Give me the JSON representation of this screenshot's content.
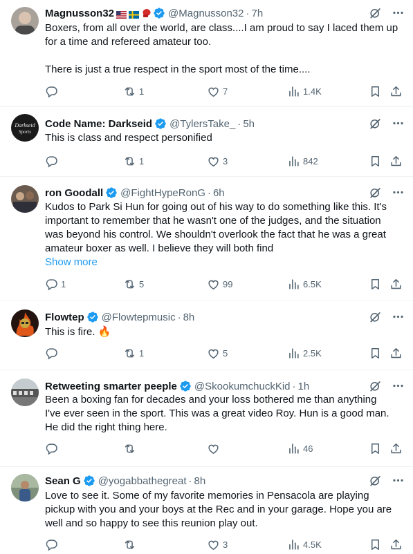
{
  "icons": {
    "verified": "verified-badge-icon",
    "grok": "grok-icon",
    "more": "more-icon",
    "reply": "reply-icon",
    "retweet": "retweet-icon",
    "like": "like-icon",
    "views": "views-icon",
    "bookmark": "bookmark-icon",
    "share": "share-icon"
  },
  "colors": {
    "verified": "#1d9bf0",
    "text": "#0f1419",
    "muted": "#536471",
    "link": "#1d9bf0"
  },
  "posts": [
    {
      "name": "Magnusson32",
      "handle": "@Magnusson32",
      "time": "7h",
      "verified": true,
      "emoji": [
        "us-flag",
        "sweden-flag",
        "boxing-glove"
      ],
      "lines": [
        "Boxers, from all over the world, are class....I am proud to say I laced them up",
        "for a time and refereed amateur too.",
        "",
        "There is just a true respect in the sport most of the time...."
      ],
      "show_more": "",
      "replies": "",
      "retweets": "1",
      "likes": "7",
      "views": "1.4K"
    },
    {
      "name": "Code Name: Darkseid",
      "handle": "@TylersTake_",
      "time": "5h",
      "verified": true,
      "lines": [
        "This is class and respect personified"
      ],
      "show_more": "",
      "replies": "",
      "retweets": "1",
      "likes": "3",
      "views": "842"
    },
    {
      "name": "ron Goodall",
      "handle": "@FightHypeRonG",
      "time": "6h",
      "verified": true,
      "lines": [
        "Kudos to Park Si Hun for going out of his way to do something like this. It's",
        "important to remember that he wasn't one of the judges, and the situation",
        "was beyond his control. We shouldn't overlook the fact that he was a great",
        "amateur boxer as well. I believe they will both find"
      ],
      "show_more": "Show more",
      "replies": "1",
      "retweets": "5",
      "likes": "99",
      "views": "6.5K"
    },
    {
      "name": "Flowtep",
      "handle": "@Flowtepmusic",
      "time": "8h",
      "verified": true,
      "lines": [
        "This is fire. 🔥"
      ],
      "show_more": "",
      "replies": "",
      "retweets": "1",
      "likes": "5",
      "views": "2.5K"
    },
    {
      "name": "Retweeting smarter peeple",
      "handle": "@SkookumchuckKid",
      "time": "1h",
      "verified": true,
      "lines": [
        "Been a boxing fan for decades and your loss bothered me than anything",
        "I've ever seen in the sport. This was a great video Roy. Hun is a good man.",
        "He did the right thing here."
      ],
      "show_more": "",
      "replies": "",
      "retweets": "",
      "likes": "",
      "views": "46"
    },
    {
      "name": "Sean G",
      "handle": "@yogabbathegreat",
      "time": "8h",
      "verified": true,
      "lines": [
        "Love to see it. Some of my favorite memories in Pensacola are playing",
        "pickup with you and your boys at the Rec and in your garage. Hope you are",
        "well and so happy to see this reunion play out."
      ],
      "show_more": "",
      "replies": "",
      "retweets": "",
      "likes": "3",
      "views": "4.5K"
    }
  ]
}
